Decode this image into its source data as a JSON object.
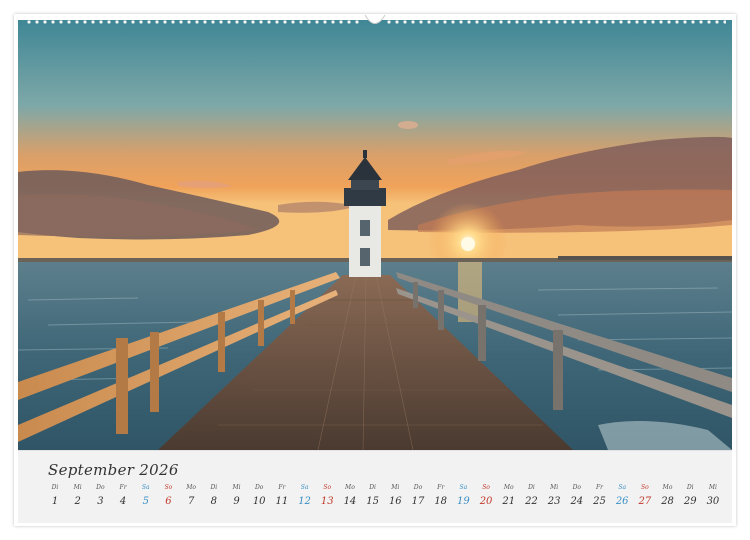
{
  "calendar": {
    "month_label": "September 2026",
    "days": [
      {
        "wd": "Di",
        "d": "1",
        "type": "weekday"
      },
      {
        "wd": "Mi",
        "d": "2",
        "type": "weekday"
      },
      {
        "wd": "Do",
        "d": "3",
        "type": "weekday"
      },
      {
        "wd": "Fr",
        "d": "4",
        "type": "weekday"
      },
      {
        "wd": "Sa",
        "d": "5",
        "type": "sat"
      },
      {
        "wd": "So",
        "d": "6",
        "type": "sun"
      },
      {
        "wd": "Mo",
        "d": "7",
        "type": "weekday"
      },
      {
        "wd": "Di",
        "d": "8",
        "type": "weekday"
      },
      {
        "wd": "Mi",
        "d": "9",
        "type": "weekday"
      },
      {
        "wd": "Do",
        "d": "10",
        "type": "weekday"
      },
      {
        "wd": "Fr",
        "d": "11",
        "type": "weekday"
      },
      {
        "wd": "Sa",
        "d": "12",
        "type": "sat"
      },
      {
        "wd": "So",
        "d": "13",
        "type": "sun"
      },
      {
        "wd": "Mo",
        "d": "14",
        "type": "weekday"
      },
      {
        "wd": "Di",
        "d": "15",
        "type": "weekday"
      },
      {
        "wd": "Mi",
        "d": "16",
        "type": "weekday"
      },
      {
        "wd": "Do",
        "d": "17",
        "type": "weekday"
      },
      {
        "wd": "Fr",
        "d": "18",
        "type": "weekday"
      },
      {
        "wd": "Sa",
        "d": "19",
        "type": "sat"
      },
      {
        "wd": "So",
        "d": "20",
        "type": "sun"
      },
      {
        "wd": "Mo",
        "d": "21",
        "type": "weekday"
      },
      {
        "wd": "Di",
        "d": "22",
        "type": "weekday"
      },
      {
        "wd": "Mi",
        "d": "23",
        "type": "weekday"
      },
      {
        "wd": "Do",
        "d": "24",
        "type": "weekday"
      },
      {
        "wd": "Fr",
        "d": "25",
        "type": "weekday"
      },
      {
        "wd": "Sa",
        "d": "26",
        "type": "sat"
      },
      {
        "wd": "So",
        "d": "27",
        "type": "sun"
      },
      {
        "wd": "Mo",
        "d": "28",
        "type": "weekday"
      },
      {
        "wd": "Di",
        "d": "29",
        "type": "weekday"
      },
      {
        "wd": "Mi",
        "d": "30",
        "type": "weekday"
      }
    ]
  },
  "photo": {
    "subject": "lighthouse-pier-sunset"
  },
  "colors": {
    "saturday": "#3a8fc5",
    "sunday": "#c0392b",
    "weekday": "#333333"
  }
}
